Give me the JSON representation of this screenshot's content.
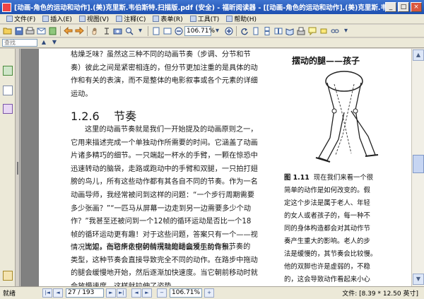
{
  "window": {
    "title": "[动画-角色的运动和动作].(美)克里斯.韦伯斯特.扫描版.pdf (安全) - 福昕阅读器 - [[动画-角色的运动和动作].(美)克里斯.韦伯斯特.扫描版.pdf (安全)]",
    "minimize": "_",
    "maximize": "□",
    "close": "×"
  },
  "menu": [
    {
      "label": "文件(F)"
    },
    {
      "label": "插入(E)"
    },
    {
      "label": "视图(V)"
    },
    {
      "label": "注释(C)"
    },
    {
      "label": "表单(R)"
    },
    {
      "label": "工具(T)"
    },
    {
      "label": "帮助(H)"
    }
  ],
  "toolbar": {
    "zoom_value": "106.71%"
  },
  "toolbar2": {
    "search_placeholder": "查找"
  },
  "document": {
    "para1": [
      "枯燥乏味？虽然这三种不同的动画节奏（步调、分节和节",
      "奏）彼此之间是紧密相连的，但分节更加注重的是具体的动",
      "作和有关的表演，而不是整体的电影叙事或各个元素的详细",
      "运动。"
    ],
    "heading_number": "1.2.6",
    "heading_text": "节奏",
    "para2": [
      "这里的动画节奏就是我们一开始提及的动画原则之一，",
      "它用来描述完成一个单独动作所需要的时间。它涵盖了动画",
      "片诸多精巧的细节。一只端起一杯水的手臂，一颗在惊恐中",
      "迅速转动的脑袋，走路或跑动中的手臂和双腿，一只拍打翅",
      "膀的鸟儿，所有这些动作都有其各自不同的节奏。作为一名",
      "动画导师，我经常被问到这样的问题：“一个步行周期需要",
      "多少张画？”“一匹马从屏幕一边走到另一边需要多少个动",
      "作？”我甚至还被问到一个12帧的循环运动是否比一个18",
      "帧的循环运动更有趣！对于这些问题，答案只有一个——视",
      "情况而定。而它所依据的情况就是动画发生的背景。"
    ],
    "para3": [
      "比如，在路步走中朝前摆动的腿会预示动作和节奏的",
      "类型，这种节奏会直接导致完全不同的动作。在路步中拖动",
      "的腿会缓慢地开始，然后逐渐加快速度。当它朝前移动时就",
      "会放慢速度，这样就拉伸了姿势。"
    ],
    "figure_title": "摆动的腿——孩子",
    "figure_caption_label": "图 1.11",
    "figure_caption": [
      "现在我们来看一个很",
      "简单的动作是如何改变的。假",
      "定这个步法是属于老人、年轻",
      "的女人或者孩子的，每一种不",
      "同的身体构造都会对其动作节",
      "奏产生重大的影响。老人的步",
      "法是缓慢的，其节奏会比较慢。",
      "他的双脚也许是虚弱的，不稳",
      "的，这会导致动作看起来小心",
      "翼翼和蹒跚跄跄。其结果是制"
    ]
  },
  "status": {
    "left": "就绪",
    "page": "27 / 193",
    "zoom": "106.71%",
    "size": "文件: [8.39 * 12.50 英寸]"
  },
  "icons": {
    "prev": "◄",
    "next": "►",
    "first": "|◄",
    "last": "►|",
    "up": "▲",
    "down": "▼"
  }
}
